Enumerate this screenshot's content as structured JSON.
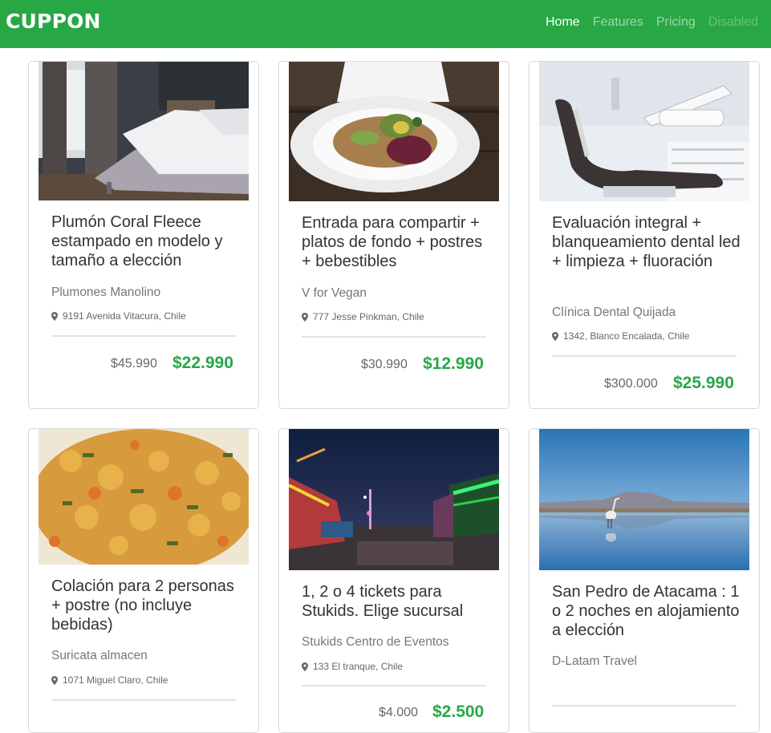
{
  "brand": "CUPPON",
  "nav": {
    "items": [
      "Home",
      "Features",
      "Pricing",
      "Disabled"
    ]
  },
  "deals": [
    {
      "title": "Plumón Coral Fleece estampado en modelo y tamaño a elección",
      "merchant": "Plumones Manolino",
      "location": "9191 Avenida Vitacura, Chile",
      "old_price": "$45.990",
      "new_price": "$22.990",
      "image": "bedroom"
    },
    {
      "title": "Entrada para compartir + platos de fondo + postres + bebestibles",
      "merchant": "V for Vegan",
      "location": "777 Jesse Pinkman, Chile",
      "old_price": "$30.990",
      "new_price": "$12.990",
      "image": "salad-plate"
    },
    {
      "title": "Evaluación integral + blanqueamiento dental led + limpieza + fluoración",
      "merchant": "Clínica Dental Quijada",
      "location": "1342, Blanco Encalada, Chile",
      "old_price": "$300.000",
      "new_price": "$25.990",
      "image": "dental-chair"
    },
    {
      "title": "Colación para 2 personas + postre (no incluye bebidas)",
      "merchant": "Suricata almacen",
      "location": "1071 Miguel Claro, Chile",
      "old_price": "",
      "new_price": "",
      "image": "stew"
    },
    {
      "title": "1, 2 o 4 tickets para Stukids. Elige sucursal",
      "merchant": "Stukids Centro de Eventos",
      "location": "133 El tranque, Chile",
      "old_price": "$4.000",
      "new_price": "$2.500",
      "image": "fair-night"
    },
    {
      "title": "San Pedro de Atacama : 1 o 2 noches en alojamiento a elección",
      "merchant": "D-Latam Travel",
      "location": "",
      "old_price": "",
      "new_price": "",
      "image": "flamingo-lake"
    }
  ]
}
